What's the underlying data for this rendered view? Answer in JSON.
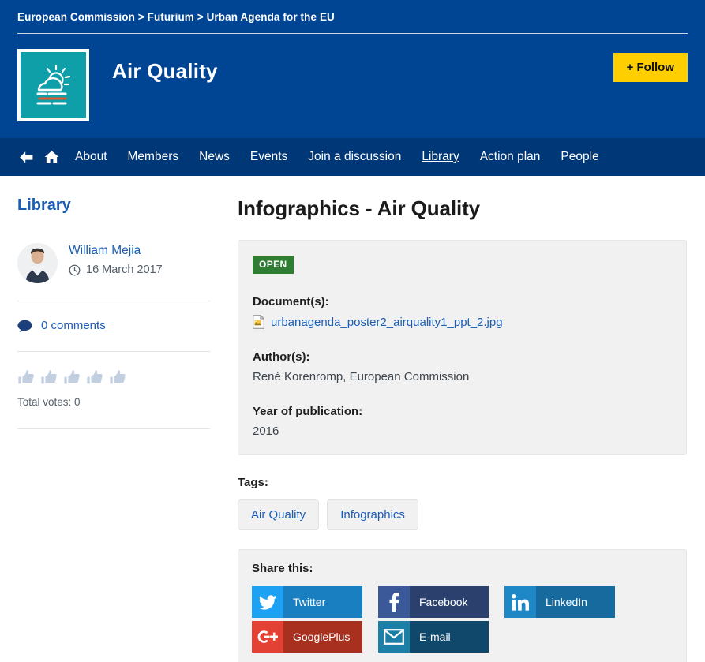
{
  "banner": {
    "breadcrumb": "European Commission > Futurium > Urban Agenda for the EU",
    "brand_title": "Air Quality",
    "follow_label": "+ Follow",
    "colors": {
      "banner_bg": "#004494",
      "nav_bg": "#003776",
      "follow_bg": "#ffce00",
      "logo_bg": "#0f9fa8",
      "logo_accent": "#e8562a"
    }
  },
  "nav": {
    "icons": [
      {
        "name": "back-arrow-icon"
      },
      {
        "name": "home-icon"
      }
    ],
    "items": [
      {
        "label": "About",
        "active": false
      },
      {
        "label": "Members",
        "active": false
      },
      {
        "label": "News",
        "active": false
      },
      {
        "label": "Events",
        "active": false
      },
      {
        "label": "Join a discussion",
        "active": false
      },
      {
        "label": "Library",
        "active": true
      },
      {
        "label": "Action plan",
        "active": false
      },
      {
        "label": "People",
        "active": false
      }
    ]
  },
  "sidebar": {
    "title": "Library",
    "author": "William Mejia",
    "date": "16 March 2017",
    "comments": "0 comments",
    "votes_total": "Total votes: 0",
    "thumbs_count": 5,
    "thumb_color": "#c2cfe0"
  },
  "main": {
    "page_title": "Infographics - Air Quality",
    "status_badge": "OPEN",
    "status_color": "#2e7d32",
    "documents_label": "Document(s):",
    "document_name": "urbanagenda_poster2_airquality1_ppt_2.jpg",
    "authors_label": "Author(s):",
    "authors_value": "René Korenromp, European Commission",
    "year_label": "Year of publication:",
    "year_value": "2016",
    "tags_label": "Tags:",
    "tags": [
      "Air Quality",
      "Infographics"
    ],
    "share_label": "Share this:",
    "share_buttons": [
      {
        "name": "Twitter",
        "icon": "twitter-icon",
        "icon_bg": "#1da1f2",
        "label_bg": "#1a7fc1"
      },
      {
        "name": "Facebook",
        "icon": "facebook-icon",
        "icon_bg": "#3b5998",
        "label_bg": "#2c406e"
      },
      {
        "name": "LinkedIn",
        "icon": "linkedin-icon",
        "icon_bg": "#1e88c7",
        "label_bg": "#176a9e"
      },
      {
        "name": "GooglePlus",
        "icon": "googleplus-icon",
        "icon_bg": "#e34133",
        "label_bg": "#a8301f"
      },
      {
        "name": "E-mail",
        "icon": "email-icon",
        "icon_bg": "#1b7fa8",
        "label_bg": "#10486b"
      }
    ]
  }
}
